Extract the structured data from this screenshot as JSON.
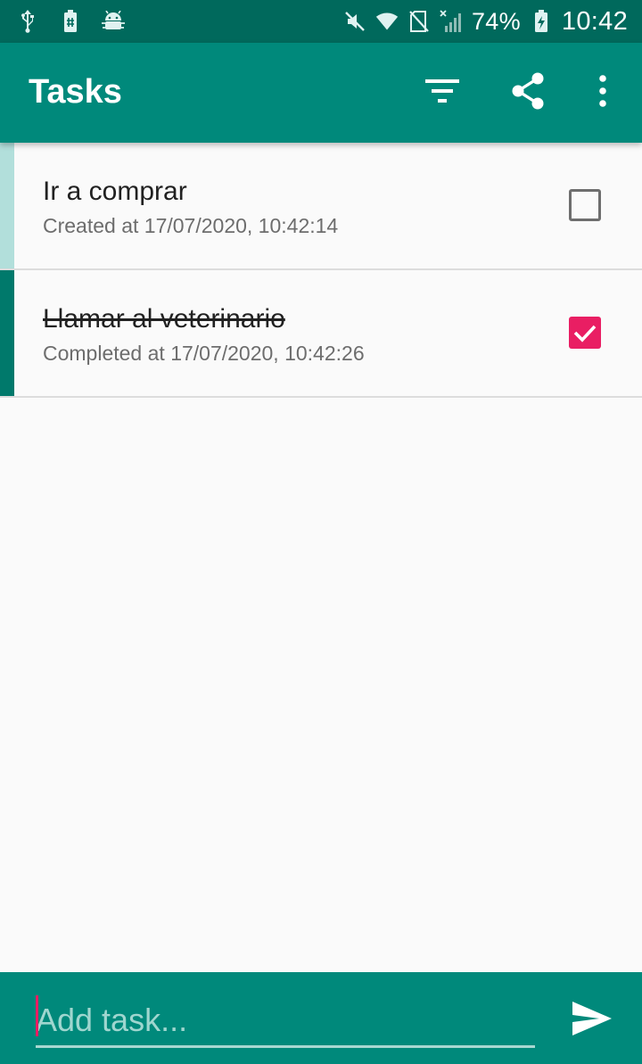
{
  "status_bar": {
    "icons_left": [
      "usb-icon",
      "battery-saver-icon",
      "android-debug-icon"
    ],
    "icons_right": [
      "mute-icon",
      "wifi-icon",
      "no-sim-icon",
      "signal-icon"
    ],
    "battery": "74%",
    "time": "10:42"
  },
  "app_bar": {
    "title": "Tasks",
    "actions": [
      "filter-icon",
      "share-icon",
      "more-vert-icon"
    ]
  },
  "tasks": [
    {
      "title": "Ir a comprar",
      "subtitle": "Created at 17/07/2020, 10:42:14",
      "completed": false
    },
    {
      "title": "Llamar al veterinario",
      "subtitle": "Completed at 17/07/2020, 10:42:26",
      "completed": true
    }
  ],
  "composer": {
    "placeholder": "Add task...",
    "value": "",
    "send_icon": "send-icon"
  },
  "colors": {
    "status_bar": "#00695c",
    "primary": "#00897b",
    "pending_strip": "#b2dfdb",
    "done_strip": "#00796b",
    "accent": "#e91e63"
  }
}
